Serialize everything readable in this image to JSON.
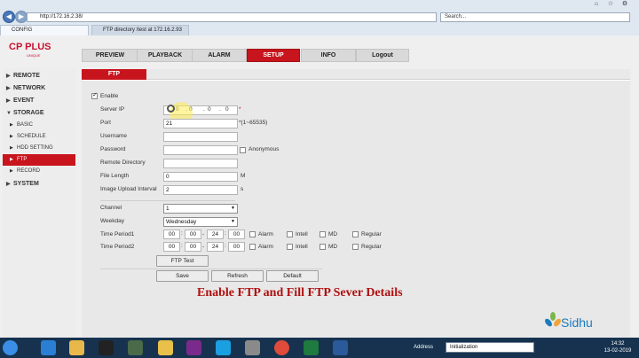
{
  "browser": {
    "address": "http://172.16.2.38/",
    "search_placeholder": "Search...",
    "tabs": [
      {
        "label": "CONFIG"
      },
      {
        "label": "FTP directory /test at 172.16.2.93"
      }
    ]
  },
  "app": {
    "logo": "CP PLUS",
    "logo_sub": "UNIQUE",
    "nav": [
      "PREVIEW",
      "PLAYBACK",
      "ALARM",
      "SETUP",
      "INFO",
      "Logout"
    ],
    "active_nav": "SETUP"
  },
  "sidebar": {
    "remote": "REMOTE",
    "network": "NETWORK",
    "event": "EVENT",
    "storage": "STORAGE",
    "basic": "BASIC",
    "schedule": "SCHEDULE",
    "hdd_setting": "HDD SETTING",
    "ftp": "FTP",
    "record": "RECORD",
    "system": "SYSTEM"
  },
  "ftp": {
    "tab": "FTP",
    "enable_label": "Enable",
    "enabled": true,
    "server_ip_label": "Server IP",
    "server_ip": [
      "0",
      "0",
      "0",
      "0"
    ],
    "server_ip_dot": ".",
    "required_mark": "*",
    "port_label": "Port",
    "port": "21",
    "port_range": "*(1~65535)",
    "username_label": "Username",
    "username": "",
    "password_label": "Password",
    "password": "",
    "anonymous_label": "Anonymous",
    "remote_dir_label": "Remote Directory",
    "remote_dir": "",
    "file_length_label": "File Length",
    "file_length": "0",
    "file_length_unit": "M",
    "upload_interval_label": "Image Upload Interval",
    "upload_interval": "2",
    "upload_interval_unit": "s",
    "channel_label": "Channel",
    "channel": "1",
    "weekday_label": "Weekday",
    "weekday": "Wednesday",
    "time_period1_label": "Time Period1",
    "time_period2_label": "Time Period2",
    "start_time": [
      "00",
      "00"
    ],
    "end_time": [
      "24",
      "00"
    ],
    "time_colon": ":",
    "time_dash": "-",
    "alarm_label": "Alarm",
    "intell_label": "Intell",
    "md_label": "MD",
    "regular_label": "Regular",
    "ftp_test_button": "FTP Test",
    "save_button": "Save",
    "refresh_button": "Refresh",
    "default_button": "Default"
  },
  "caption": "Enable FTP and Fill FTP Sever Details",
  "watermark": "Sidhu",
  "taskbar": {
    "address_label": "Address",
    "address_value": "Initialization",
    "time": "14:32",
    "date": "13-02-2019"
  }
}
